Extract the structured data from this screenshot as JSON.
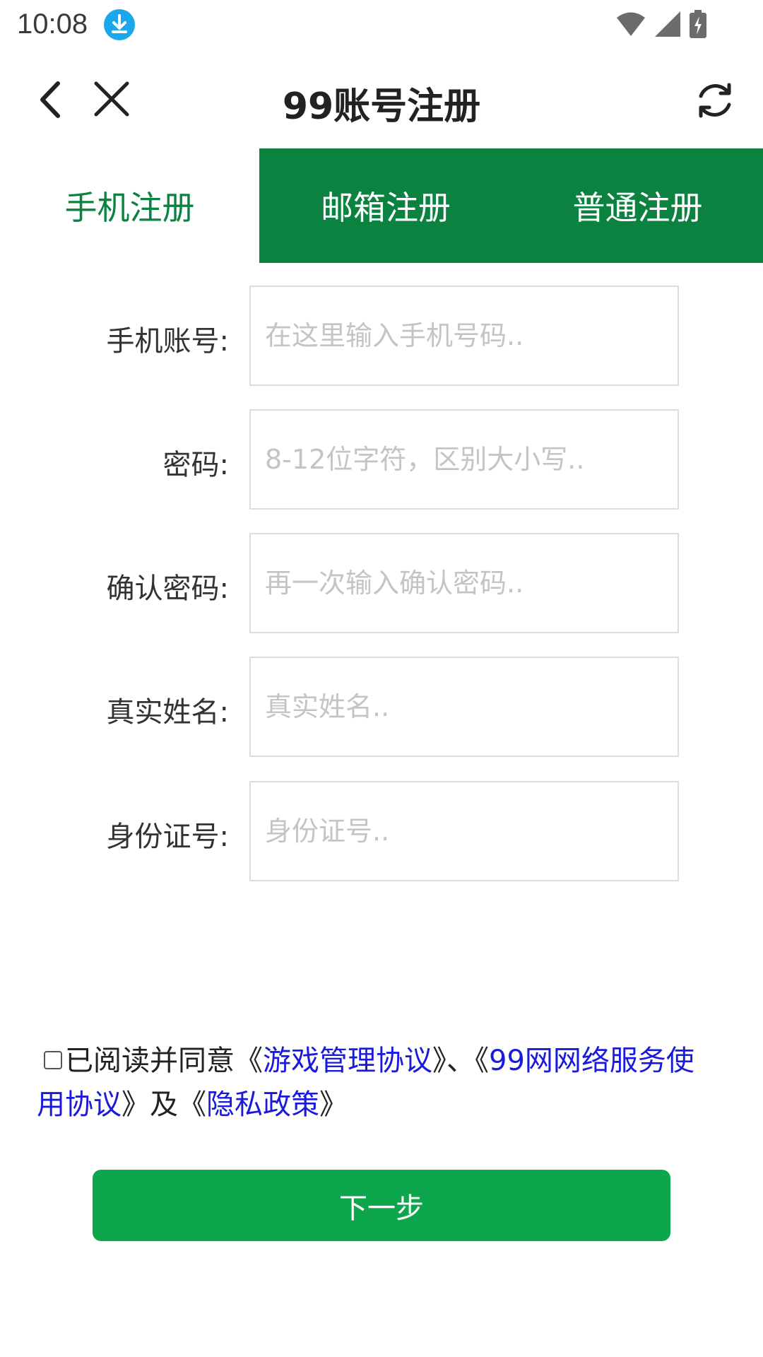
{
  "status_bar": {
    "time": "10:08",
    "icons": [
      "download-icon",
      "wifi-icon",
      "signal-icon",
      "battery-charging-icon"
    ],
    "download_icon_color": "#1aa7ec"
  },
  "nav": {
    "title": "99账号注册",
    "icons": [
      "back-arrow-icon",
      "close-icon",
      "refresh-icon"
    ]
  },
  "tabs": [
    {
      "label": "手机注册",
      "active": true
    },
    {
      "label": "邮箱注册",
      "active": false
    },
    {
      "label": "普通注册",
      "active": false
    }
  ],
  "form": {
    "fields": [
      {
        "label": "手机账号:",
        "placeholder": "在这里输入手机号码..",
        "value": ""
      },
      {
        "label": "密码:",
        "placeholder": "8-12位字符，区别大小写..",
        "value": ""
      },
      {
        "label": "确认密码:",
        "placeholder": "再一次输入确认密码..",
        "value": ""
      },
      {
        "label": "真实姓名:",
        "placeholder": "真实姓名..",
        "value": ""
      },
      {
        "label": "身份证号:",
        "placeholder": "身份证号..",
        "value": ""
      }
    ]
  },
  "agreement": {
    "checked": false,
    "prefix": "已阅读并同意《",
    "link1": "游戏管理协议",
    "mid1": "》、《",
    "link2": "99网网络服务使用协议",
    "mid2": "》及《",
    "link3": "隐私政策",
    "suffix": "》"
  },
  "next_button": {
    "label": "下一步"
  },
  "colors": {
    "brand_green": "#0b8240",
    "button_green": "#0ea64d",
    "link_blue": "#1a1adb"
  }
}
